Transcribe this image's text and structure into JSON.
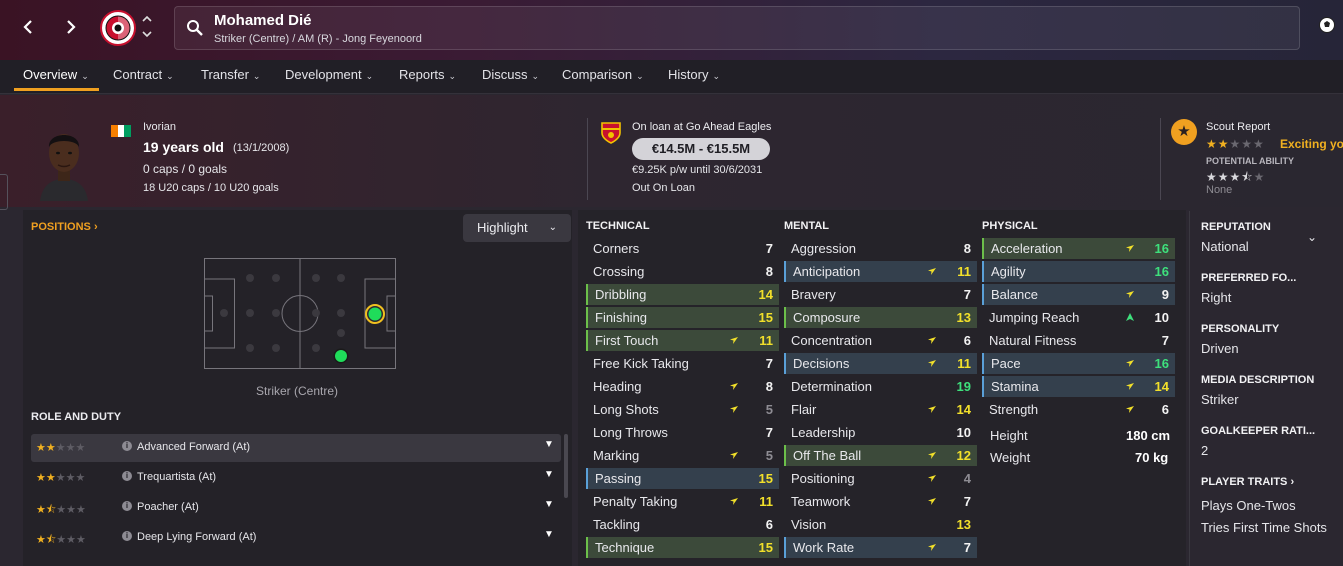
{
  "header": {
    "player_name": "Mohamed Dié",
    "player_subtitle": "Striker (Centre) / AM (R) - Jong Feyenoord",
    "back_icon": "chevron-left-icon",
    "forward_icon": "chevron-right-icon"
  },
  "menu": [
    {
      "label": "Overview",
      "active": true
    },
    {
      "label": "Contract"
    },
    {
      "label": "Transfer"
    },
    {
      "label": "Development"
    },
    {
      "label": "Reports"
    },
    {
      "label": "Discuss"
    },
    {
      "label": "Comparison"
    },
    {
      "label": "History"
    }
  ],
  "profile": {
    "nationality": "Ivorian",
    "age": "19 years old",
    "dob": "(13/1/2008)",
    "caps": "0 caps / 0 goals",
    "u20_caps": "18 U20 caps / 10 U20 goals",
    "flag_colors": [
      "#f77f00",
      "#ffffff",
      "#009e60"
    ]
  },
  "loan": {
    "status": "On loan at Go Ahead Eagles",
    "value": "€14.5M - €15.5M",
    "wage": "€9.25K p/w until 30/6/2031",
    "note": "Out On Loan"
  },
  "scout": {
    "label": "Scout Report",
    "summary": "Exciting yo",
    "potential_label": "POTENTIAL ABILITY",
    "potential_value": "None",
    "current_stars": 2,
    "potential_stars": 3.5
  },
  "positions": {
    "title": "POSITIONS",
    "title_arrow": "›",
    "highlight_label": "Highlight",
    "selected_position": "Striker (Centre)"
  },
  "roles": {
    "title": "ROLE AND DUTY",
    "items": [
      {
        "name": "Advanced Forward (At)",
        "stars": 2
      },
      {
        "name": "Trequartista (At)",
        "stars": 2
      },
      {
        "name": "Poacher (At)",
        "stars": 1.5
      },
      {
        "name": "Deep Lying Forward (At)",
        "stars": 1.5
      }
    ]
  },
  "attributes": {
    "technical": {
      "title": "TECHNICAL",
      "items": [
        {
          "name": "Corners",
          "value": "7",
          "color": "white"
        },
        {
          "name": "Crossing",
          "value": "8",
          "color": "white"
        },
        {
          "name": "Dribbling",
          "value": "14",
          "color": "yellow",
          "hl": "green"
        },
        {
          "name": "Finishing",
          "value": "15",
          "color": "yellow",
          "hl": "green"
        },
        {
          "name": "First Touch",
          "value": "11",
          "color": "yellow",
          "hl": "green",
          "arrow": "down"
        },
        {
          "name": "Free Kick Taking",
          "value": "7",
          "color": "white"
        },
        {
          "name": "Heading",
          "value": "8",
          "color": "white",
          "arrow": "down"
        },
        {
          "name": "Long Shots",
          "value": "5",
          "color": "grey",
          "arrow": "down"
        },
        {
          "name": "Long Throws",
          "value": "7",
          "color": "white"
        },
        {
          "name": "Marking",
          "value": "5",
          "color": "grey",
          "arrow": "down"
        },
        {
          "name": "Passing",
          "value": "15",
          "color": "yellow",
          "hl": "blue"
        },
        {
          "name": "Penalty Taking",
          "value": "11",
          "color": "yellow",
          "arrow": "down"
        },
        {
          "name": "Tackling",
          "value": "6",
          "color": "white"
        },
        {
          "name": "Technique",
          "value": "15",
          "color": "yellow",
          "hl": "green"
        }
      ]
    },
    "mental": {
      "title": "MENTAL",
      "items": [
        {
          "name": "Aggression",
          "value": "8",
          "color": "white"
        },
        {
          "name": "Anticipation",
          "value": "11",
          "color": "yellow",
          "hl": "blue",
          "arrow": "down"
        },
        {
          "name": "Bravery",
          "value": "7",
          "color": "white"
        },
        {
          "name": "Composure",
          "value": "13",
          "color": "yellow",
          "hl": "green"
        },
        {
          "name": "Concentration",
          "value": "6",
          "color": "white",
          "arrow": "down"
        },
        {
          "name": "Decisions",
          "value": "11",
          "color": "yellow",
          "hl": "blue",
          "arrow": "down"
        },
        {
          "name": "Determination",
          "value": "19",
          "color": "green"
        },
        {
          "name": "Flair",
          "value": "14",
          "color": "yellow",
          "arrow": "down"
        },
        {
          "name": "Leadership",
          "value": "10",
          "color": "white"
        },
        {
          "name": "Off The Ball",
          "value": "12",
          "color": "yellow",
          "hl": "green",
          "arrow": "down"
        },
        {
          "name": "Positioning",
          "value": "4",
          "color": "grey",
          "arrow": "down"
        },
        {
          "name": "Teamwork",
          "value": "7",
          "color": "white",
          "arrow": "down"
        },
        {
          "name": "Vision",
          "value": "13",
          "color": "yellow"
        },
        {
          "name": "Work Rate",
          "value": "7",
          "color": "white",
          "hl": "blue",
          "arrow": "down"
        }
      ]
    },
    "physical": {
      "title": "PHYSICAL",
      "items": [
        {
          "name": "Acceleration",
          "value": "16",
          "color": "green",
          "hl": "green",
          "arrow": "down"
        },
        {
          "name": "Agility",
          "value": "16",
          "color": "green",
          "hl": "blue"
        },
        {
          "name": "Balance",
          "value": "9",
          "color": "white",
          "hl": "blue",
          "arrow": "down"
        },
        {
          "name": "Jumping Reach",
          "value": "10",
          "color": "white",
          "arrow": "up"
        },
        {
          "name": "Natural Fitness",
          "value": "7",
          "color": "white"
        },
        {
          "name": "Pace",
          "value": "16",
          "color": "green",
          "hl": "blue",
          "arrow": "down"
        },
        {
          "name": "Stamina",
          "value": "14",
          "color": "yellow",
          "hl": "blue",
          "arrow": "down"
        },
        {
          "name": "Strength",
          "value": "6",
          "color": "white",
          "arrow": "down"
        }
      ],
      "height_label": "Height",
      "height_value": "180 cm",
      "weight_label": "Weight",
      "weight_value": "70 kg"
    }
  },
  "side": {
    "reputation_label": "REPUTATION",
    "reputation_value": "National",
    "foot_label": "PREFERRED FO...",
    "foot_value": "Right",
    "personality_label": "PERSONALITY",
    "personality_value": "Driven",
    "media_label": "MEDIA DESCRIPTION",
    "media_value": "Striker",
    "gk_label": "GOALKEEPER RATI...",
    "gk_value": "2",
    "traits_label": "PLAYER TRAITS",
    "traits_arrow": "›",
    "traits": [
      "Plays One-Twos",
      "Tries First Time Shots"
    ]
  }
}
